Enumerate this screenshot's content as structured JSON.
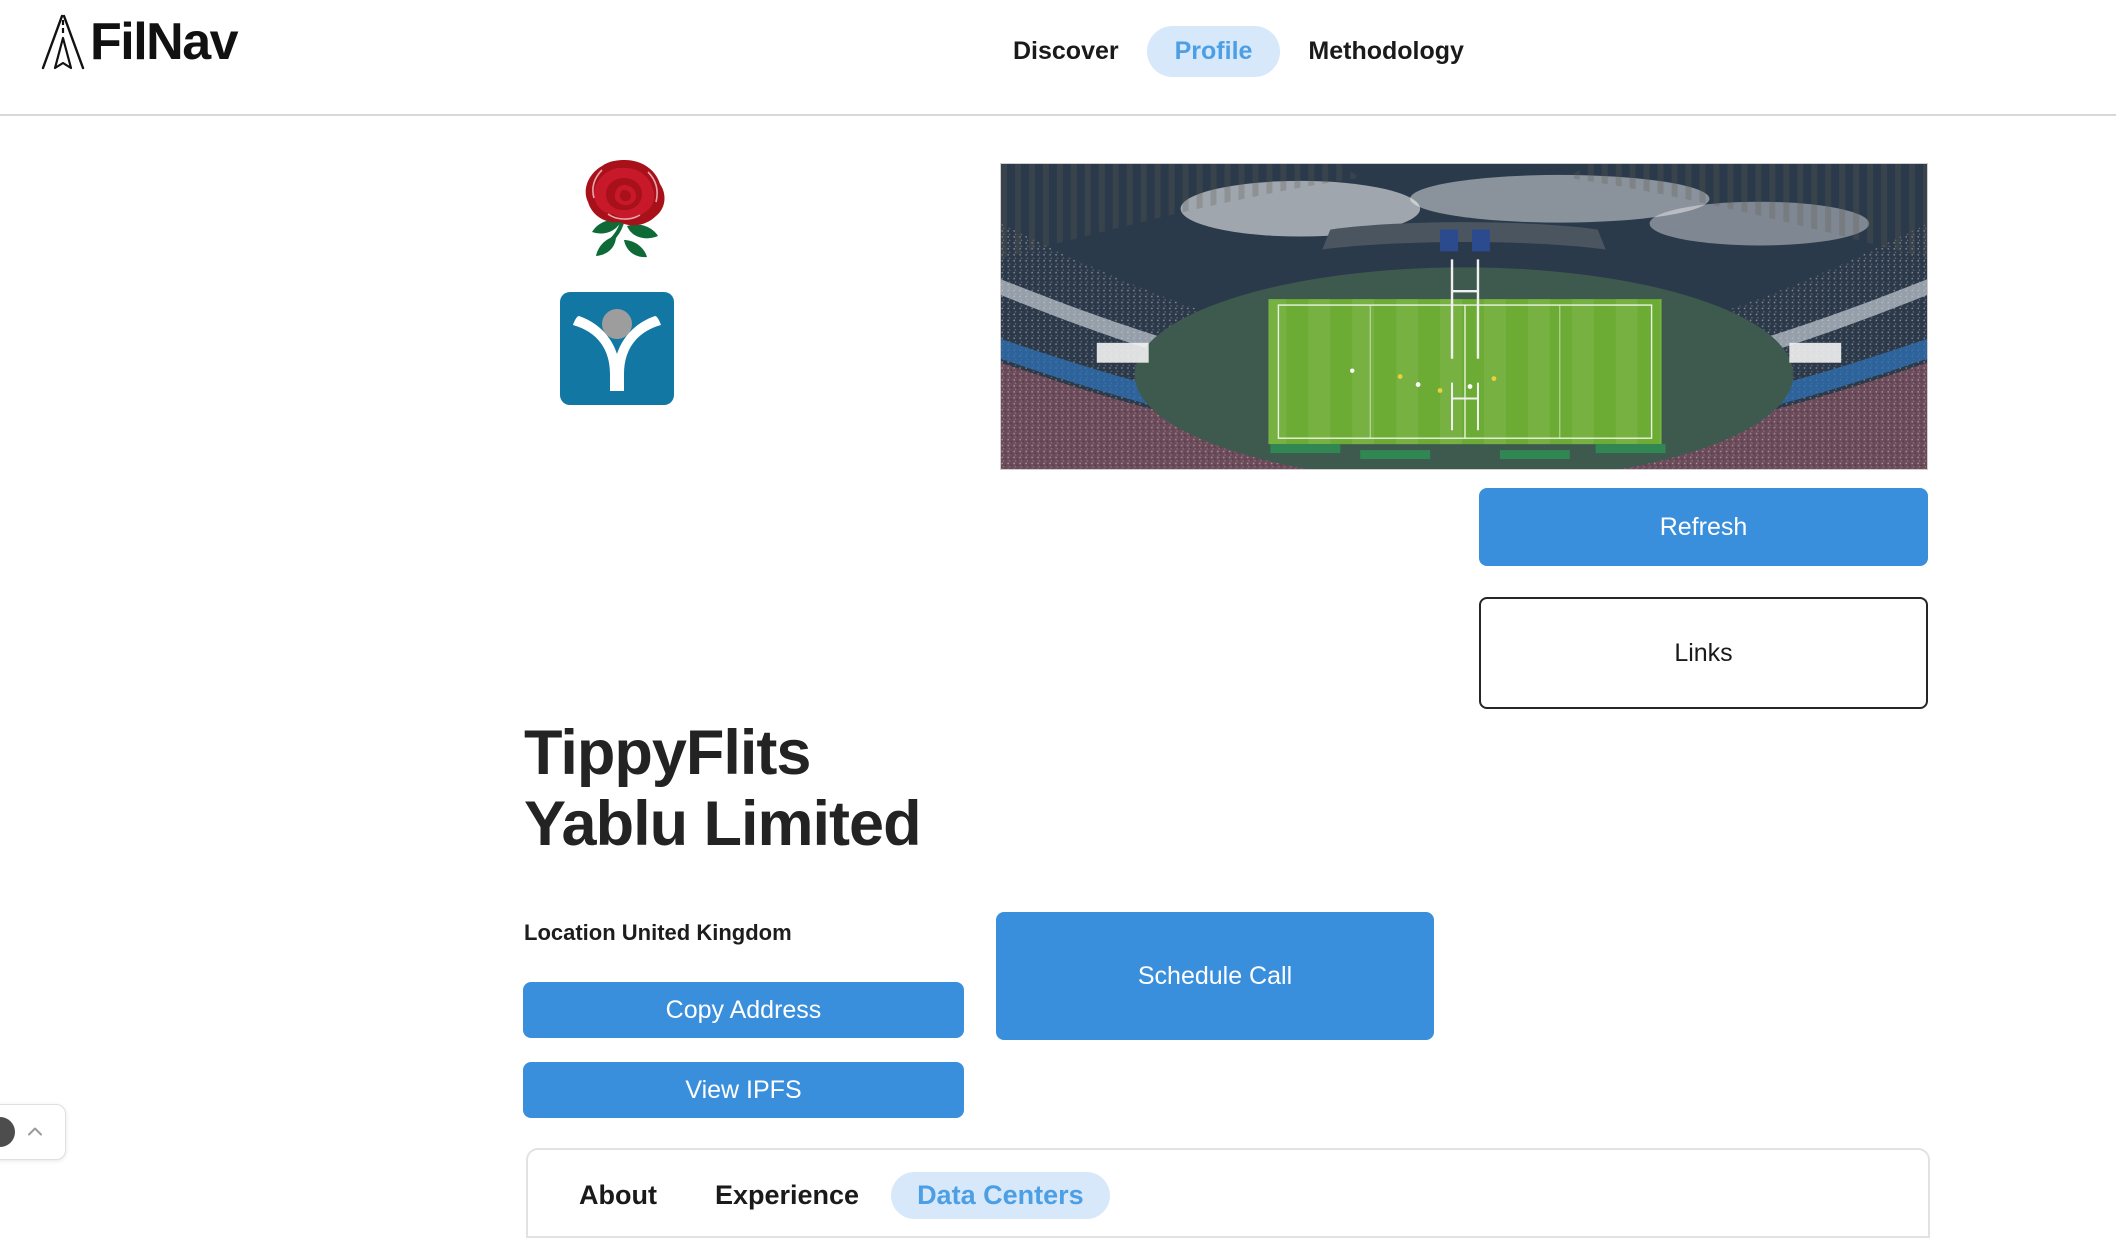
{
  "brand": {
    "name": "FilNav",
    "mark_icon": "navigation-arrow-icon"
  },
  "nav": {
    "items": [
      {
        "label": "Discover",
        "active": false
      },
      {
        "label": "Profile",
        "active": true
      },
      {
        "label": "Methodology",
        "active": false
      }
    ]
  },
  "logos": [
    {
      "name": "england-rugby-rose-logo",
      "alt": "Red rose emblem"
    },
    {
      "name": "blue-square-figure-logo",
      "alt": "Blue square logo with white figure"
    }
  ],
  "hero": {
    "image_name": "rugby-stadium-photo",
    "alt": "Aerial view of a packed rugby stadium with green pitch"
  },
  "side_actions": {
    "refresh_label": "Refresh",
    "links_label": "Links"
  },
  "profile": {
    "title_line1": "TippyFlits",
    "title_line2": "Yablu Limited",
    "location_label": "Location United Kingdom",
    "copy_address_label": "Copy Address",
    "view_ipfs_label": "View IPFS",
    "schedule_call_label": "Schedule Call"
  },
  "tabs": [
    {
      "label": "About",
      "active": false
    },
    {
      "label": "Experience",
      "active": false
    },
    {
      "label": "Data Centers",
      "active": true
    }
  ],
  "float_widget": {
    "avatar_icon": "avatar-circle-icon",
    "chevron_icon": "chevron-up-icon"
  },
  "colors": {
    "accent_blue": "#3a8fdd",
    "pill_bg": "#d6e8fa",
    "pill_text": "#4c9fe5",
    "text_dark": "#1a1a1a",
    "border_light": "#e2e2e2",
    "logo_square_blue": "#1277a3",
    "rose_red": "#b5121b",
    "leaf_green": "#0e6b38"
  }
}
